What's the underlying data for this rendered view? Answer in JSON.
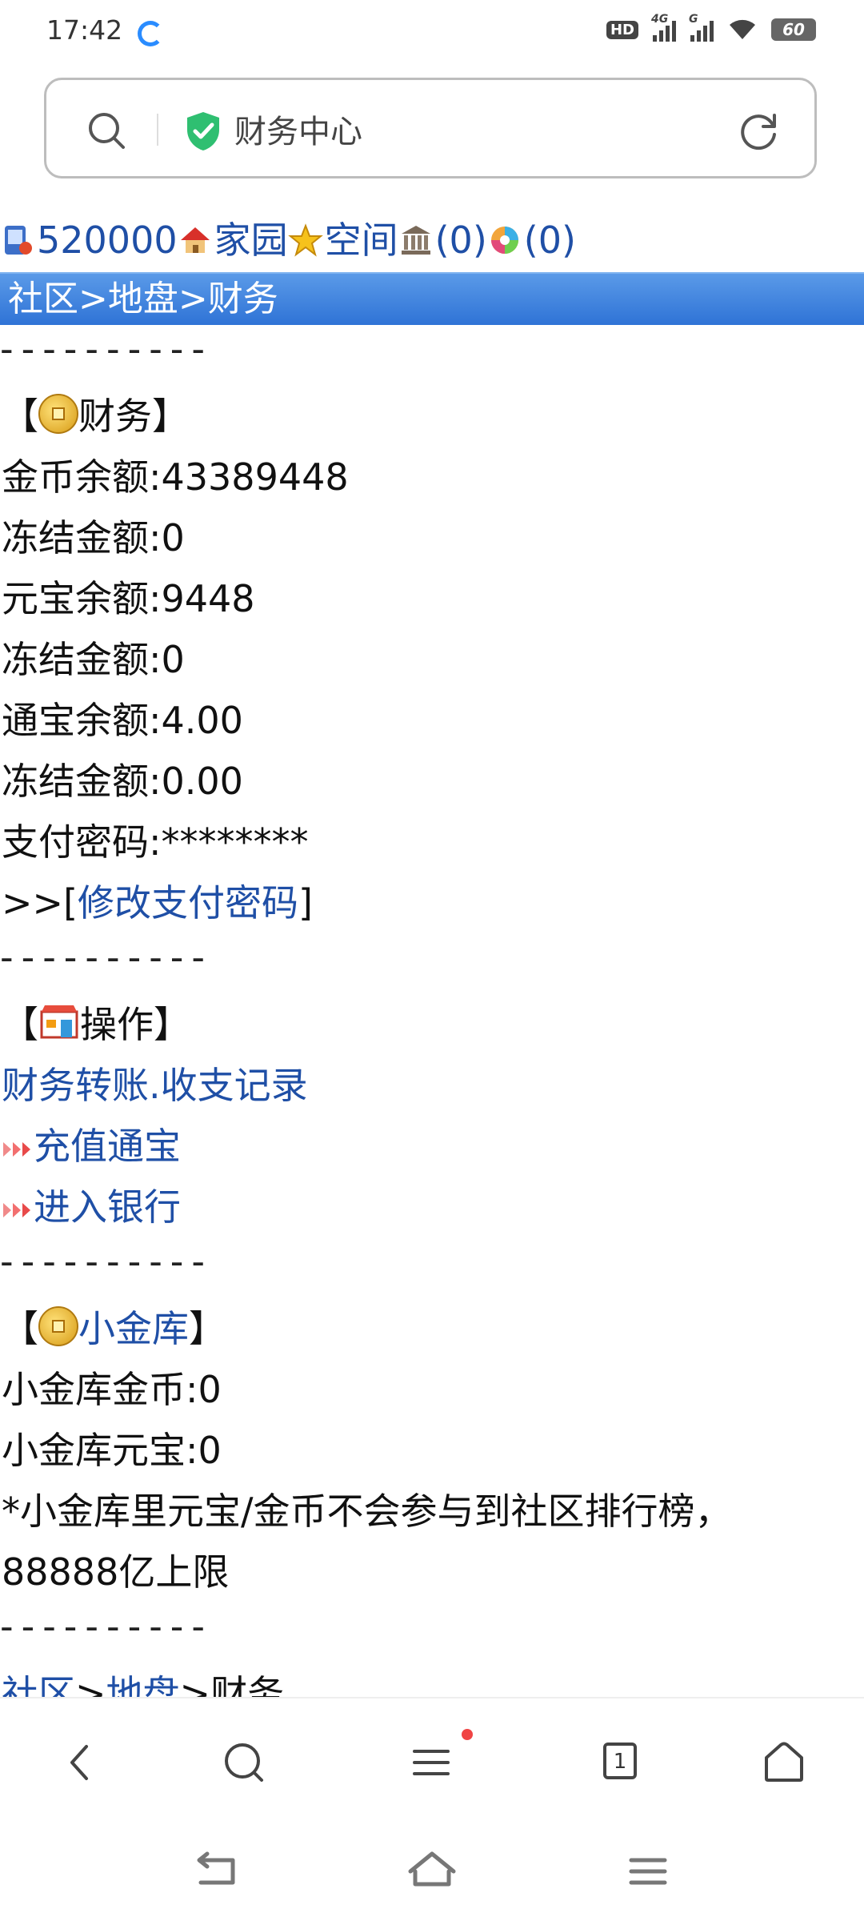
{
  "status": {
    "time": "17:42",
    "hd": "HD",
    "sig1": "4G",
    "sig2": "G",
    "battery": "60"
  },
  "urlbar": {
    "title": "财务中心"
  },
  "topnav": {
    "money": "520000",
    "home": "家园",
    "space": "空间",
    "bank_count": "(0)",
    "msg_count": "(0)"
  },
  "breadcrumb": {
    "community": "社区",
    "sep1": ">",
    "land": "地盘",
    "sep2": ">",
    "finance": "财务"
  },
  "dashes": "----------",
  "finance": {
    "open": "【",
    "title": "财务",
    "close": "】",
    "gold_balance": "金币余额:43389448",
    "frozen1": "冻结金额:0",
    "yuanbao_balance": "元宝余额:9448",
    "frozen2": "冻结金额:0",
    "tongbao_balance": "通宝余额:4.00",
    "frozen3": "冻结金额:0.00",
    "pay_password": "支付密码:********",
    "change_prefix": ">>[",
    "change_link": "修改支付密码",
    "change_suffix": "]"
  },
  "operations": {
    "open": "【",
    "title": "操作",
    "close": "】",
    "transfer": "财务转账",
    "dot": ".",
    "records": "收支记录",
    "recharge": "充值通宝",
    "bank": "进入银行"
  },
  "vault": {
    "open": "【",
    "title": "小金库",
    "close": "】",
    "gold": "小金库金币:0",
    "yuanbao": "小金库元宝:0",
    "note1": "*小金库里元宝/金币不会参与到社区排行榜，",
    "note2": "88888亿上限"
  },
  "footer_crumb": {
    "community": "社区",
    "sep1": ">",
    "land": "地盘",
    "sep2": ">",
    "finance": "财务"
  },
  "toolbar": {
    "tabs_count": "1"
  },
  "colors": {
    "link": "#1f4fa6",
    "crumb_bar": "#2f73d6",
    "notification": "#f04444"
  }
}
